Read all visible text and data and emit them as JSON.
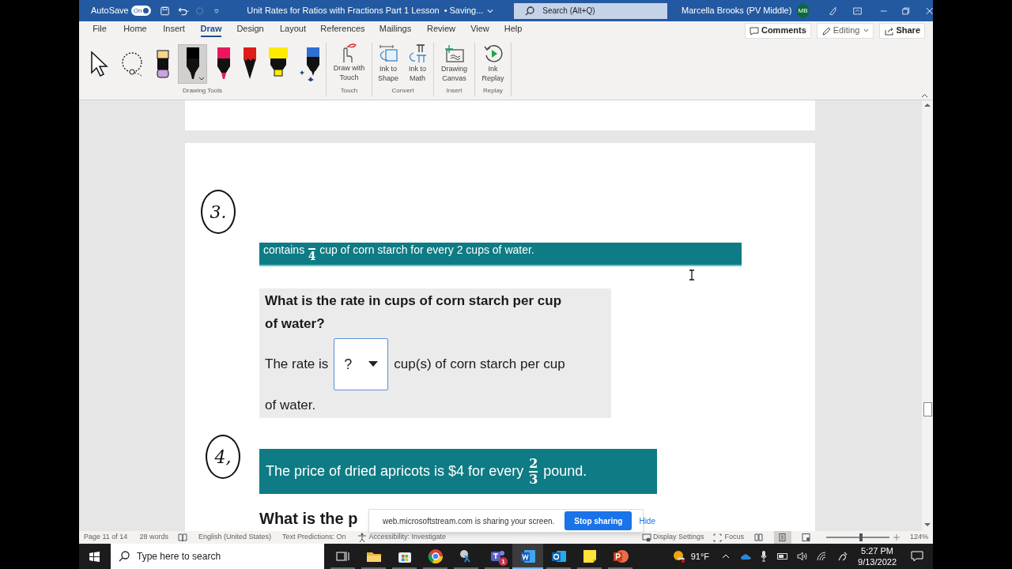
{
  "title_bar": {
    "autosave_label": "AutoSave",
    "autosave_toggle": {
      "text": "On",
      "on": true
    },
    "document_title": "Unit Rates for Ratios with Fractions Part 1 Lesson",
    "save_status": "• Saving...",
    "search_placeholder": "Search (Alt+Q)",
    "user_name": "Marcella Brooks (PV Middle)",
    "avatar_initials": "MB"
  },
  "menu_tabs": [
    {
      "label": "File",
      "selected": false
    },
    {
      "label": "Home",
      "selected": false
    },
    {
      "label": "Insert",
      "selected": false
    },
    {
      "label": "Draw",
      "selected": true
    },
    {
      "label": "Design",
      "selected": false
    },
    {
      "label": "Layout",
      "selected": false
    },
    {
      "label": "References",
      "selected": false
    },
    {
      "label": "Mailings",
      "selected": false
    },
    {
      "label": "Review",
      "selected": false
    },
    {
      "label": "View",
      "selected": false
    },
    {
      "label": "Help",
      "selected": false
    }
  ],
  "ribbon_actions": [
    {
      "label": "Comments",
      "kind": "comments"
    },
    {
      "label": "Editing",
      "kind": "editing"
    },
    {
      "label": "Share",
      "kind": "share"
    }
  ],
  "drawing_tools": {
    "label": "Drawing Tools",
    "tools": [
      {
        "kind": "select",
        "selected": false
      },
      {
        "kind": "lasso",
        "selected": false
      },
      {
        "kind": "eraser",
        "selected": false
      },
      {
        "kind": "pen",
        "color": "#000000",
        "selected": true
      },
      {
        "kind": "pen",
        "color": "#e8175d",
        "selected": false
      },
      {
        "kind": "pencil",
        "color": "#e01b1b",
        "selected": false
      },
      {
        "kind": "highlighter",
        "color": "#ffeb00",
        "selected": false
      },
      {
        "kind": "action_pen",
        "color": "#2e6fd1",
        "selected": false
      }
    ]
  },
  "ribbon_groups": [
    {
      "label": "Touch",
      "buttons": [
        {
          "label": "Draw with Touch",
          "kind": "touch"
        }
      ]
    },
    {
      "label": "Convert",
      "buttons": [
        {
          "label": "Ink to Shape",
          "kind": "shape"
        },
        {
          "label": "Ink to Math",
          "kind": "math"
        }
      ]
    },
    {
      "label": "Insert",
      "buttons": [
        {
          "label": "Drawing Canvas",
          "kind": "canvas"
        }
      ]
    },
    {
      "label": "Replay",
      "buttons": [
        {
          "label": "Ink Replay",
          "kind": "replay"
        }
      ]
    }
  ],
  "document": {
    "question_3": {
      "ink_marker": "3.",
      "banner": {
        "before": "contains",
        "denominator": "4",
        "after": "cup of corn starch for every 2 cups of water."
      },
      "question": "What is the rate in cups of corn starch per cup of water?",
      "answer_prefix": "The rate is",
      "dropdown": "?",
      "answer_suffix": "cup(s) of corn starch per cup",
      "answer_continuation": "of water."
    },
    "question_4": {
      "ink_marker": "4,",
      "banner": {
        "before": "The price of dried apricots is $4 for every",
        "numerator": "2",
        "denominator": "3",
        "after": "pound."
      },
      "question_start": "What is the p"
    }
  },
  "sharing_bar": {
    "message": "web.microsoftstream.com is sharing your screen.",
    "stop_button": "Stop sharing",
    "hide_link": "Hide"
  },
  "status_bar": {
    "page": "Page 11 of 14",
    "words": "28 words",
    "language": "English (United States)",
    "text_predictions": "Text Predictions: On",
    "accessibility": "Accessibility: Investigate",
    "display_settings": "Display Settings",
    "focus": "Focus",
    "views": [
      {
        "kind": "read",
        "selected": false
      },
      {
        "kind": "print",
        "selected": true
      },
      {
        "kind": "web",
        "selected": false
      }
    ],
    "zoom": {
      "level": 0.55,
      "reading": "124%"
    }
  },
  "taskbar": {
    "search_placeholder": "Type here to search",
    "apps": [
      {
        "kind": "task_view",
        "selected": false
      },
      {
        "kind": "explorer",
        "selected": false
      },
      {
        "kind": "store",
        "selected": false
      },
      {
        "kind": "chrome",
        "selected": false
      },
      {
        "kind": "snip",
        "selected": false
      },
      {
        "kind": "teams",
        "selected": false,
        "badge": "1"
      },
      {
        "kind": "word",
        "selected": true
      },
      {
        "kind": "outlook",
        "selected": false
      },
      {
        "kind": "sticky",
        "selected": false
      },
      {
        "kind": "powerpoint",
        "selected": false
      }
    ],
    "temperature": "91°F",
    "time": "5:27 PM",
    "date": "9/13/2022"
  }
}
